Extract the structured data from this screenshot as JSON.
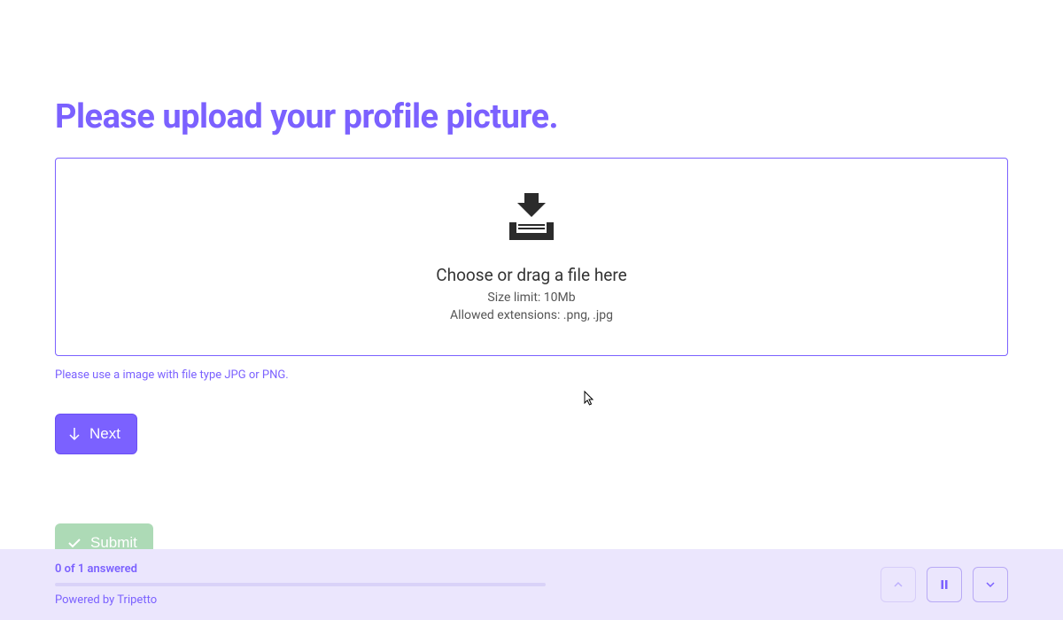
{
  "title": "Please upload your profile picture.",
  "upload": {
    "primary_text": "Choose or drag a file here",
    "size_limit": "Size limit: 10Mb",
    "allowed_extensions": "Allowed extensions: .png, .jpg"
  },
  "helper_text": "Please use a image with file type JPG or PNG.",
  "buttons": {
    "next_label": "Next",
    "submit_label": "Submit"
  },
  "footer": {
    "progress_text": "0 of 1 answered",
    "powered_by": "Powered by Tripetto"
  }
}
